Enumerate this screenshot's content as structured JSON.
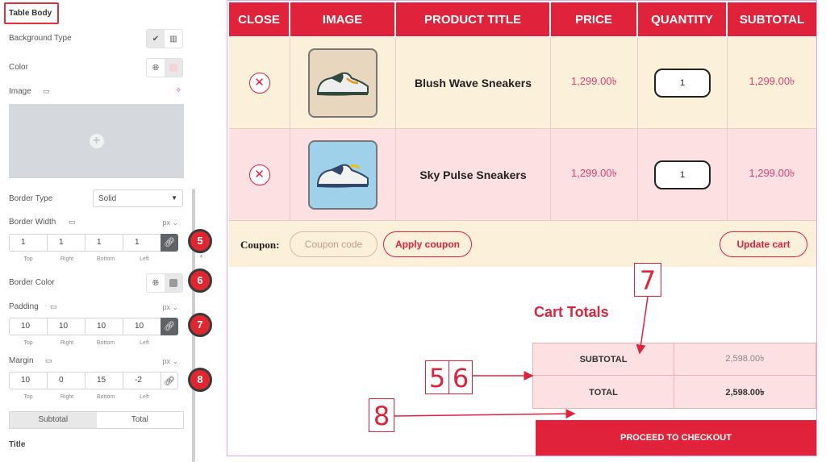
{
  "panel": {
    "title": "Table Body",
    "background_type_label": "Background Type",
    "color_label": "Color",
    "image_label": "Image",
    "border_type_label": "Border Type",
    "border_type_value": "Solid",
    "border_width_label": "Border Width",
    "border_width_unit": "px",
    "border_width": {
      "top": "1",
      "right": "1",
      "bottom": "1",
      "left": "1"
    },
    "border_color_label": "Border Color",
    "padding_label": "Padding",
    "padding_unit": "px",
    "padding": {
      "top": "10",
      "right": "10",
      "bottom": "10",
      "left": "10"
    },
    "margin_label": "Margin",
    "margin_unit": "px",
    "margin": {
      "top": "10",
      "right": "0",
      "bottom": "15",
      "left": "-2"
    },
    "dim_labels": {
      "top": "Top",
      "right": "Right",
      "bottom": "Bottom",
      "left": "Left"
    },
    "tabs": [
      "Subtotal",
      "Total"
    ],
    "title_label": "Title",
    "badges": [
      "5",
      "6",
      "7",
      "8"
    ],
    "color_swatch": "#f6d4d6",
    "border_color_swatch": "#9a9a9a"
  },
  "cart": {
    "headers": [
      "CLOSE",
      "IMAGE",
      "PRODUCT TITLE",
      "PRICE",
      "QUANTITY",
      "SUBTOTAL"
    ],
    "rows": [
      {
        "title": "Blush Wave Sneakers",
        "price": "1,299.00৳",
        "qty": "1",
        "subtotal": "1,299.00৳",
        "bg": "#fbf0da",
        "thumb_bg": "#e9d6bf"
      },
      {
        "title": "Sky Pulse Sneakers",
        "price": "1,299.00৳",
        "qty": "1",
        "subtotal": "1,299.00৳",
        "bg": "#fde0e1",
        "thumb_bg": "#9fd2ea"
      }
    ],
    "coupon_label": "Coupon:",
    "coupon_placeholder": "Coupon code",
    "apply_coupon": "Apply coupon",
    "update_cart": "Update cart",
    "totals_title": "Cart Totals",
    "totals": [
      {
        "label": "SUBTOTAL",
        "value": "2,598.00৳"
      },
      {
        "label": "TOTAL",
        "value": "2,598.00৳"
      }
    ],
    "checkout": "PROCEED TO CHECKOUT",
    "accent": "#e0233b"
  },
  "annotations": {
    "box_7": "7",
    "box_5": "5",
    "box_6": "6",
    "box_8": "8"
  }
}
